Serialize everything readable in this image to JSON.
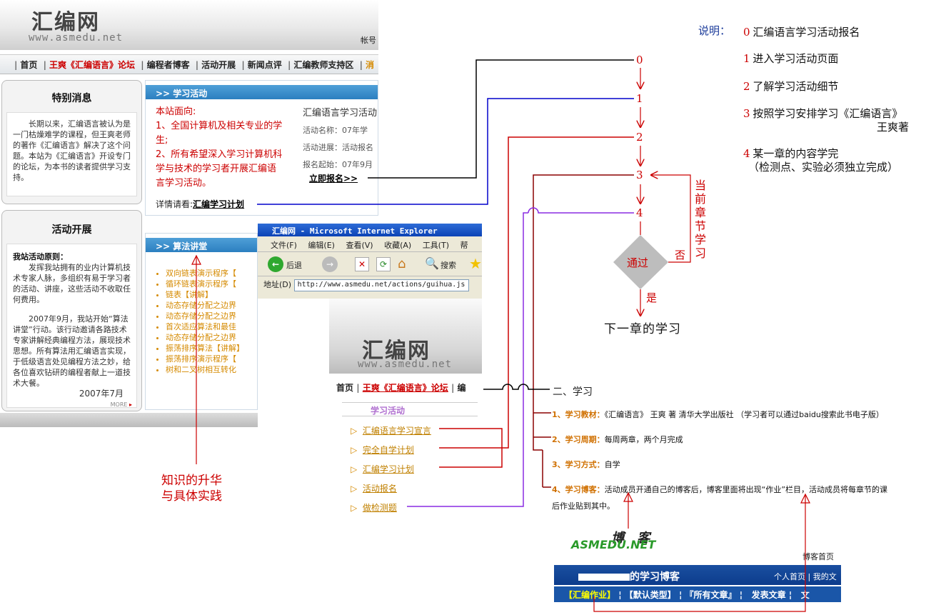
{
  "legend": {
    "title": "说明：",
    "items": [
      {
        "num": "0",
        "text": "汇编语言学习活动报名"
      },
      {
        "num": "1",
        "text": "进入学习活动页面"
      },
      {
        "num": "2",
        "text": "了解学习活动细节"
      },
      {
        "num": "3",
        "text": "按照学习安排学习《汇编语言》",
        "text2": "王爽著"
      },
      {
        "num": "4",
        "text": "某一章的内容学完",
        "text2": "（检测点、实验必须独立完成）"
      }
    ]
  },
  "flow": {
    "nodes": [
      "0",
      "1",
      "2",
      "3",
      "4"
    ],
    "decision": "通过",
    "no_label": "否",
    "yes_label": "是",
    "loop_label": "当前章节学习",
    "next": "下一章的学习"
  },
  "site": {
    "logo": "汇编网",
    "logo_sub": "www.asmedu.net",
    "account": "帐号",
    "nav": [
      "首页",
      "王爽《汇编语言》论坛",
      "编程者博客",
      "活动开展",
      "新闻点评",
      "汇编教师支持区",
      "消"
    ],
    "special": {
      "title": "特别消息",
      "text": "长期以来，汇编语言被认为是一门枯燥难学的课程，但王爽老师的著作《汇编语言》解决了这个问题。本站为《汇编语言》开设专门的论坛，为本书的读者提供学习支持。"
    },
    "activity": {
      "title": "活动开展",
      "principle": "我站活动原则：",
      "p1": "发挥我站拥有的业内计算机技术专家人脉，多组织有易于学习者的活动、讲座，这些活动不收取任何费用。",
      "p2": "2007年9月，我站开始“算法讲堂”行动。该行动邀请各路技术专家讲解经典编程方法，展现技术思想。所有算法用汇编语言实现，于低级语言处见编程方法之妙，给各位喜欢钻研的编程者献上一道技术大餐。",
      "date": "2007年7月",
      "more": "MORE"
    },
    "study": {
      "bar": ">> 学习活动",
      "target_title": "本站面向:",
      "t1": "1、全国计算机及相关专业的学生;",
      "t2": "2、所有希望深入学习计算机科学与技术的学习者开展汇编语言学习活动。",
      "detail": "详情请看:",
      "detail_link": "汇编学习计划",
      "col_title": "汇编语言学习活动",
      "f1": "活动名称：07年学",
      "f2": "活动进展：活动报名",
      "f3": "报名起始：07年9月",
      "signup": "立即报名>>"
    },
    "algo": {
      "bar": ">> 算法讲堂",
      "items": [
        "双向链表演示程序【",
        "循环链表演示程序【",
        "链表【讲解】",
        "动态存储分配之边界",
        "动态存储分配之边界",
        "首次适应算法和最佳",
        "动态存储分配之边界",
        "振荡排序算法【讲解】",
        "振荡排序演示程序【",
        "树和二叉树相互转化"
      ]
    },
    "annotation": [
      "知识的升华",
      "与具体实践"
    ]
  },
  "ie": {
    "title": "汇编网 - Microsoft Internet Explorer",
    "menu": [
      "文件(F)",
      "编辑(E)",
      "查看(V)",
      "收藏(A)",
      "工具(T)",
      "帮"
    ],
    "back": "后退",
    "search": "搜索",
    "address_label": "地址(D)",
    "address": "http://www.asmedu.net/actions/guihua.js",
    "logo": "汇编网",
    "logo_sub": "www.asmedu.net",
    "nav": [
      "首页",
      "王爽《汇编语言》论坛",
      "编"
    ],
    "side_title": "学习活动",
    "side_items": [
      "汇编语言学习宣言",
      "完全自学计划",
      "汇编学习计划",
      "活动报名",
      "做检测题"
    ]
  },
  "plan": {
    "heading": "二、学习",
    "items": [
      {
        "key": "1、学习教材：",
        "val": "《汇编语言》 王爽 著 清华大学出版社 （学习者可以通过baidu搜索此书电子版）"
      },
      {
        "key": "2、学习周期：",
        "val": "每周两章，两个月完成"
      },
      {
        "key": "3、学习方式：",
        "val": "自学"
      },
      {
        "key": "4、学习博客：",
        "val": "活动成员开通自己的博客后，博客里面将出现“作业”栏目，活动成员将每章节的课",
        "val2": "后作业贴到其中。"
      }
    ]
  },
  "blog": {
    "title": "博 客",
    "brand": "ASMEDU.NET",
    "home": "博客首页",
    "name": "的学习博客",
    "links": "个人首页 | 我的文",
    "menu": [
      "【汇编作业】",
      "【默认类型】",
      "『所有文章』",
      "发表文章",
      "文"
    ]
  },
  "colors": {
    "black_line": "#000000",
    "blue_line": "#0000cc",
    "red_line": "#cc0000",
    "darkred_line": "#8b0000",
    "purple_line": "#8a2be2",
    "decision": "#bdbdbd"
  }
}
